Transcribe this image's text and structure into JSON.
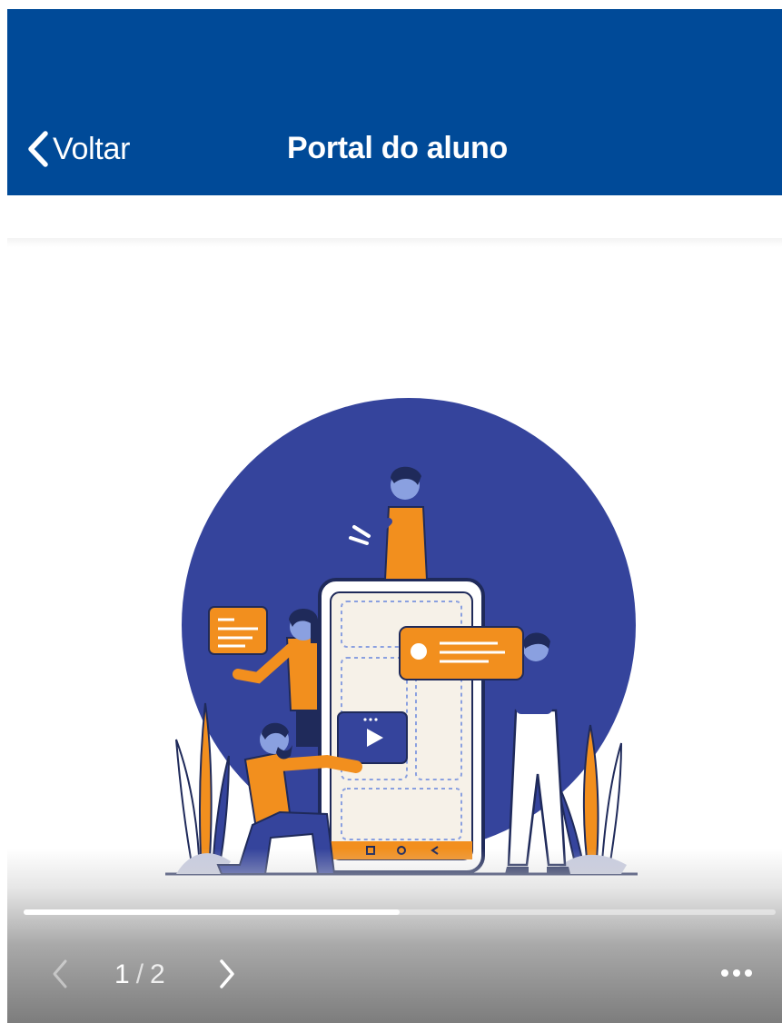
{
  "colors": {
    "header_bg": "#004a98",
    "header_text": "#ffffff",
    "illustration_circle": "#35449c",
    "illustration_accent": "#f28f1e"
  },
  "header": {
    "back_label": "Voltar",
    "title": "Portal do aluno"
  },
  "viewer": {
    "illustration": "people-with-smartphone-illustration",
    "current_page": "1",
    "total_pages": "2",
    "progress": 0.5,
    "icons": {
      "back": "chevron-left-icon",
      "prev": "chevron-left-icon",
      "next": "chevron-right-icon",
      "more": "more-horizontal-icon"
    }
  }
}
